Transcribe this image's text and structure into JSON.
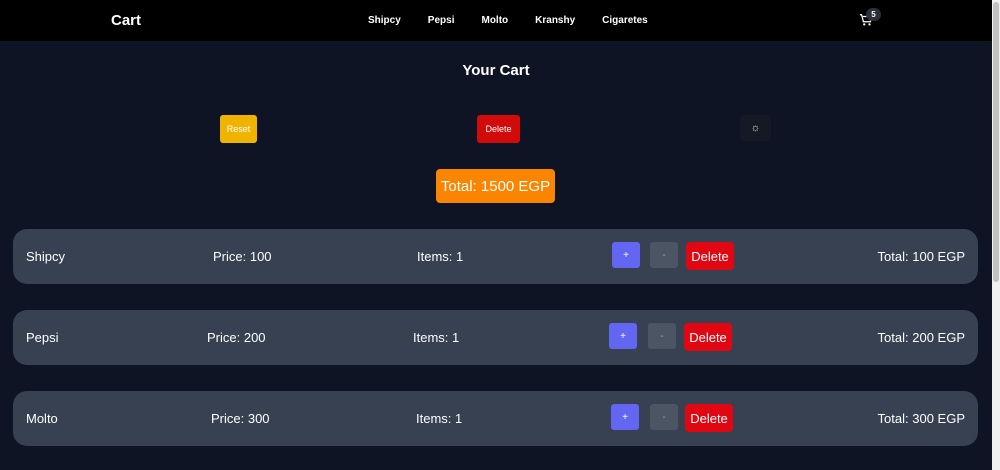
{
  "navbar": {
    "brand": "Cart",
    "links": [
      "Shipcy",
      "Pepsi",
      "Molto",
      "Kranshy",
      "Cigaretes"
    ],
    "cart_count": "5"
  },
  "page": {
    "title": "Your Cart",
    "reset_label": "Reset",
    "delete_label": "Delete",
    "theme_symbol": "☼",
    "total": "Total: 1500 EGP"
  },
  "items": [
    {
      "name": "Shipcy",
      "price": "Price: 100",
      "count": "Items: 1",
      "plus": "+",
      "minus": "-",
      "delete": "Delete",
      "total": "Total: 100 EGP"
    },
    {
      "name": "Pepsi",
      "price": "Price: 200",
      "count": "Items: 1",
      "plus": "+",
      "minus": "-",
      "delete": "Delete",
      "total": "Total: 200 EGP"
    },
    {
      "name": "Molto",
      "price": "Price: 300",
      "count": "Items: 1",
      "plus": "+",
      "minus": "-",
      "delete": "Delete",
      "total": "Total: 300 EGP"
    }
  ],
  "colors": {
    "background": "#0f1424",
    "card": "#374151",
    "reset": "#f0b400",
    "delete": "#d10a0a",
    "total_badge": "#fb8500",
    "plus": "#6366f1",
    "minus": "#4b5563"
  }
}
